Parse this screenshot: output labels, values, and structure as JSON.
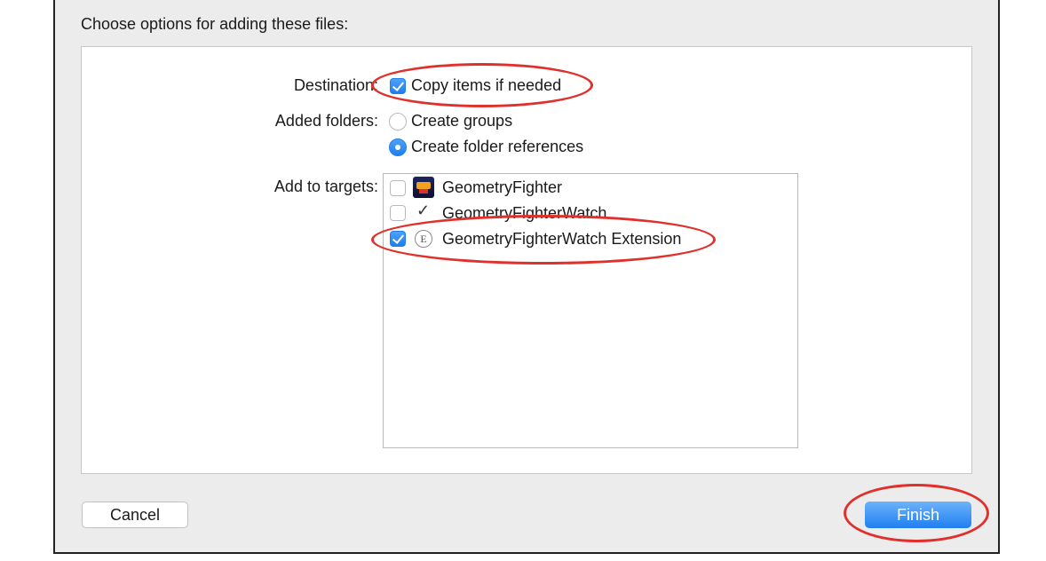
{
  "dialog": {
    "heading": "Choose options for adding these files:"
  },
  "destination": {
    "label": "Destination:",
    "copy_items": {
      "label": "Copy items if needed",
      "checked": true
    }
  },
  "added_folders": {
    "label": "Added folders:",
    "options": [
      {
        "label": "Create groups",
        "selected": false
      },
      {
        "label": "Create folder references",
        "selected": true
      }
    ]
  },
  "targets": {
    "label": "Add to targets:",
    "items": [
      {
        "name": "GeometryFighter",
        "checked": false,
        "icon": "app-icon"
      },
      {
        "name": "GeometryFighterWatch",
        "checked": false,
        "icon": "watch-icon"
      },
      {
        "name": "GeometryFighterWatch Extension",
        "checked": true,
        "icon": "extension-icon"
      }
    ]
  },
  "buttons": {
    "cancel": "Cancel",
    "finish": "Finish"
  },
  "annotation_color": "#e0302c",
  "accent_color": "#1f7ff0",
  "icons": {
    "watch_glyph": "✓",
    "extension_glyph": "E"
  }
}
